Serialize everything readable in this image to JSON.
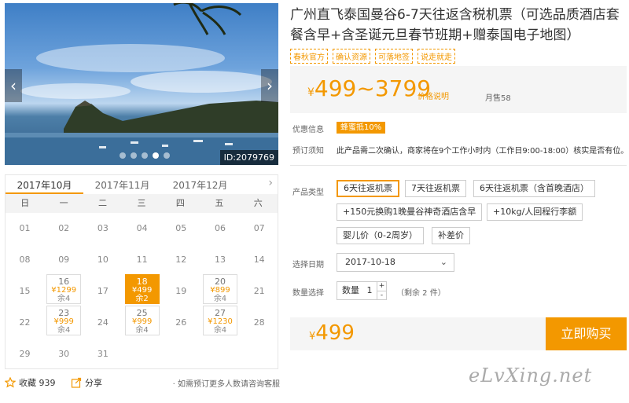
{
  "gallery": {
    "prev_arrow": "‹",
    "next_arrow": "›",
    "image_id": "ID:2079769",
    "dots": 5,
    "active_dot": 3
  },
  "calendar": {
    "months": [
      "2017年10月",
      "2017年11月",
      "2017年12月"
    ],
    "active_month": 0,
    "next_arrow": "›",
    "weekdays": [
      "日",
      "一",
      "二",
      "三",
      "四",
      "五",
      "六"
    ],
    "days": [
      {
        "day": "01"
      },
      {
        "day": "02"
      },
      {
        "day": "03"
      },
      {
        "day": "04"
      },
      {
        "day": "05"
      },
      {
        "day": "06"
      },
      {
        "day": "07"
      },
      {
        "day": "08"
      },
      {
        "day": "09"
      },
      {
        "day": "10"
      },
      {
        "day": "11"
      },
      {
        "day": "12"
      },
      {
        "day": "13"
      },
      {
        "day": "14"
      },
      {
        "day": "15"
      },
      {
        "day": "16",
        "price": "¥1299",
        "remain": "余4"
      },
      {
        "day": "17"
      },
      {
        "day": "18",
        "price": "¥499",
        "remain": "余2",
        "selected": true
      },
      {
        "day": "19"
      },
      {
        "day": "20",
        "price": "¥899",
        "remain": "余4"
      },
      {
        "day": "21"
      },
      {
        "day": "22"
      },
      {
        "day": "23",
        "price": "¥999",
        "remain": "余4"
      },
      {
        "day": "24"
      },
      {
        "day": "25",
        "price": "¥999",
        "remain": "余4"
      },
      {
        "day": "26"
      },
      {
        "day": "27",
        "price": "¥1230",
        "remain": "余4"
      },
      {
        "day": "28"
      },
      {
        "day": "29"
      },
      {
        "day": "30"
      },
      {
        "day": "31"
      }
    ]
  },
  "bottom": {
    "favorite_label": "收藏 939",
    "share_label": "分享",
    "consult_note": "· 如需预订更多人数请咨询客服"
  },
  "product": {
    "title": "广州直飞泰国曼谷6-7天往返含税机票（可选品质酒店套餐含早+含圣诞元旦春节班期+赠泰国电子地图）",
    "tags": [
      "春秋官方",
      "确认资源",
      "可落地签",
      "说走就走"
    ],
    "price_yen": "¥",
    "price_range": "499~3799",
    "price_note": "价格说明",
    "monthly_sales": "月售58",
    "discount_label": "优惠信息",
    "coupon": "蜂蜜抵10%",
    "notice_label": "预订须知",
    "notice_text": "此产品需二次确认，商家将在9个工作小时内（工作日9:00-18:00）核实是否有位。",
    "type_label": "产品类型",
    "options": [
      "6天往返机票",
      "7天往返机票",
      "6天往返机票（含首晚酒店）",
      "+150元换购1晚曼谷神奇酒店含早",
      "+10kg/人回程行李额",
      "婴儿价（0-2周岁）",
      "补差价"
    ],
    "selected_option": 0,
    "date_label": "选择日期",
    "date_value": "2017-10-18",
    "date_chevron": "⌄",
    "qty_label": "数量选择",
    "qty_text": "数量",
    "qty_value": "1",
    "qty_plus": "+",
    "qty_minus": "-",
    "stock_text": "（剩余 2 件）",
    "total_yen": "¥",
    "total_price": "499",
    "buy_label": "立即购买"
  },
  "watermark": "eLvXing.net",
  "colors": {
    "accent": "#f39800"
  }
}
